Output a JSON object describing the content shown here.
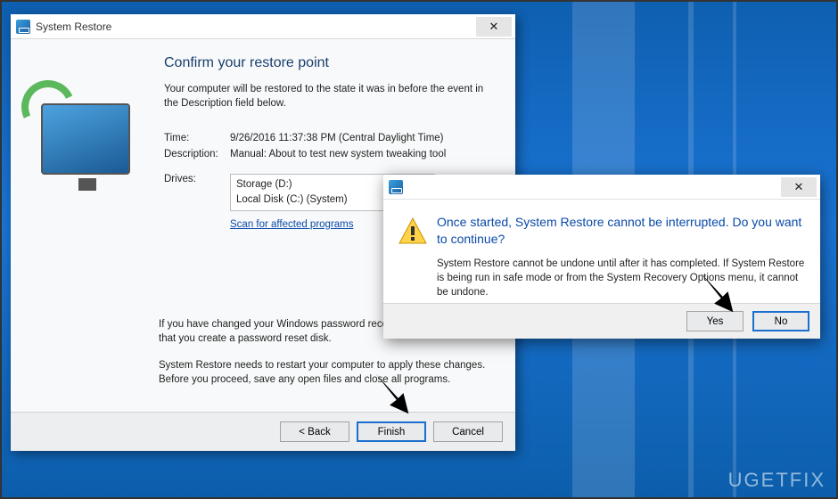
{
  "desktop": {
    "watermark": "UGETFIX"
  },
  "wizard": {
    "title": "System Restore",
    "heading": "Confirm your restore point",
    "subtext": "Your computer will be restored to the state it was in before the event in the Description field below.",
    "labels": {
      "time": "Time:",
      "description": "Description:",
      "drives": "Drives:"
    },
    "time": "9/26/2016 11:37:38 PM (Central Daylight Time)",
    "description": "Manual: About to test new system tweaking tool",
    "drives": [
      "Storage (D:)",
      "Local Disk (C:) (System)"
    ],
    "scan_link": "Scan for affected programs",
    "note1": "If you have changed your Windows password recently, we recommend that you create a password reset disk.",
    "note2": "System Restore needs to restart your computer to apply these changes. Before you proceed, save any open files and close all programs.",
    "buttons": {
      "back": "< Back",
      "finish": "Finish",
      "cancel": "Cancel"
    }
  },
  "dialog": {
    "heading": "Once started, System Restore cannot be interrupted. Do you want to continue?",
    "message": "System Restore cannot be undone until after it has completed. If System Restore is being run in safe mode or from the System Recovery Options menu, it cannot be undone.",
    "buttons": {
      "yes": "Yes",
      "no": "No"
    }
  }
}
